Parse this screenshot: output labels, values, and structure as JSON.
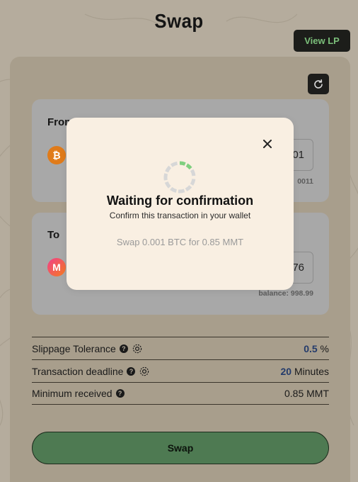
{
  "header": {
    "title": "Swap",
    "view_lp_label": "View LP"
  },
  "from": {
    "label": "From",
    "token_icon": "bitcoin-icon",
    "amount_partial": "01",
    "balance_partial": "0011"
  },
  "to": {
    "label": "To",
    "token_icon": "mmt-token-icon",
    "amount_partial": "76",
    "balance": "balance: 998.99"
  },
  "settings": {
    "slippage": {
      "label": "Slippage Tolerance",
      "value": "0.5",
      "unit": "%"
    },
    "deadline": {
      "label": "Transaction deadline",
      "value": "20",
      "unit": "Minutes"
    },
    "minimum": {
      "label": "Minimum received",
      "value": "0.85 MMT"
    }
  },
  "swap_button_label": "Swap",
  "modal": {
    "title": "Waiting for confirmation",
    "subtitle": "Confirm this transaction in your wallet",
    "detail": "Swap 0.001 BTC for 0.85 MMT"
  },
  "colors": {
    "accent_green": "#4e7a52",
    "value_blue": "#243b6b",
    "modal_bg": "#f9efe2"
  }
}
